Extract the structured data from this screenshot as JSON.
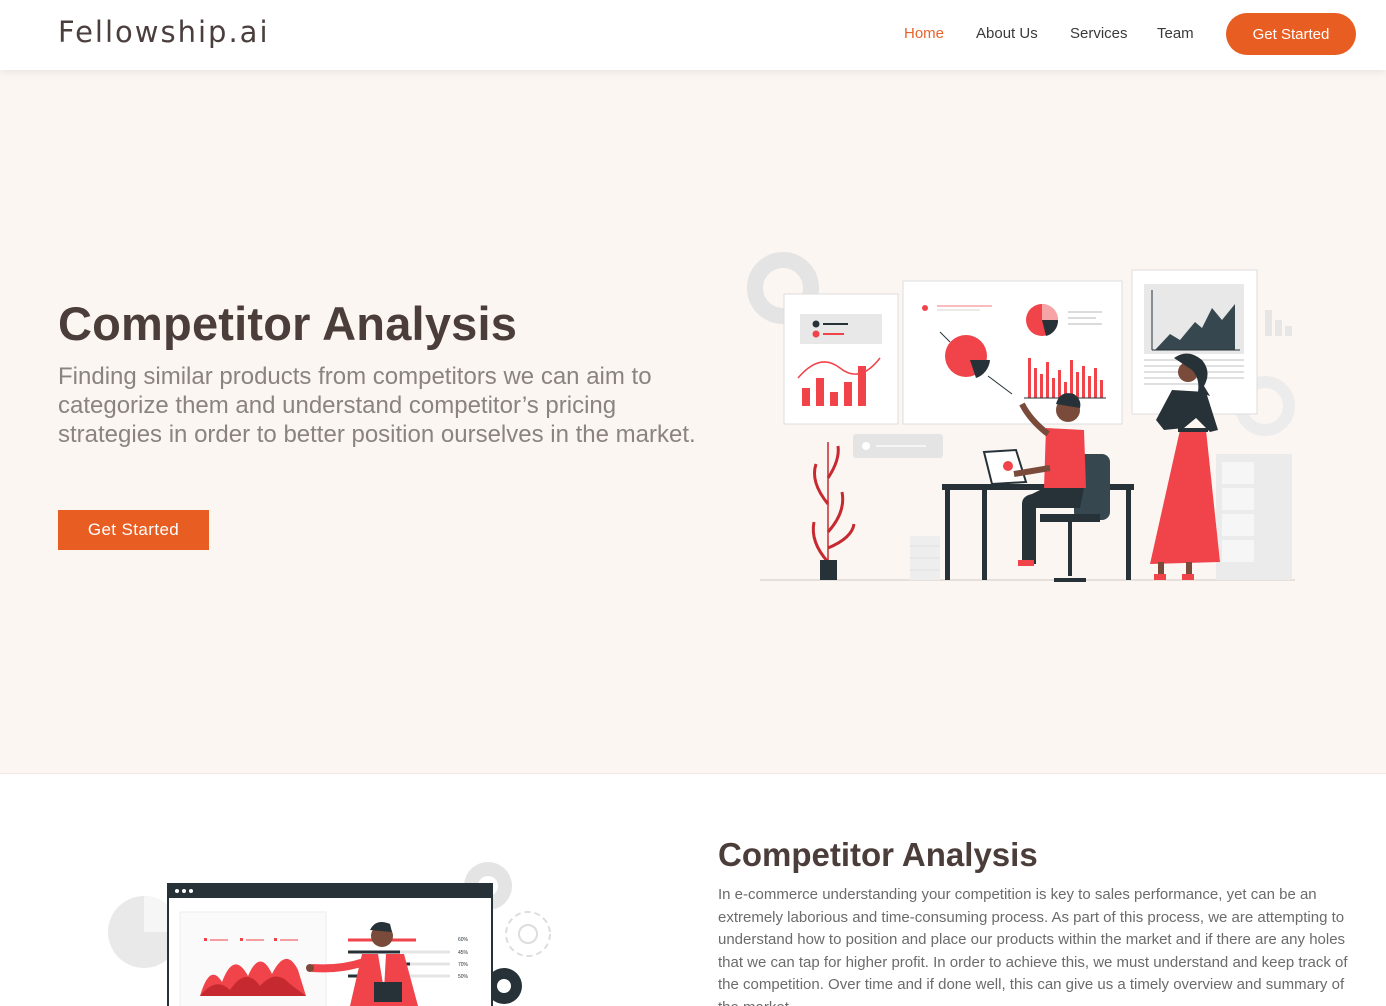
{
  "header": {
    "logo": "Fellowship.ai",
    "nav": [
      {
        "label": "Home",
        "active": true
      },
      {
        "label": "About Us",
        "active": false
      },
      {
        "label": "Services",
        "active": false
      },
      {
        "label": "Team",
        "active": false
      }
    ],
    "cta_label": "Get Started"
  },
  "hero": {
    "title": "Competitor Analysis",
    "description": "Finding similar products from competitors we can aim to categorize them and understand competitor’s pricing strategies in order to better position ourselves in the market.",
    "button_label": "Get Started"
  },
  "section2": {
    "title": "Competitor Analysis",
    "body": "In e-commerce understanding your competition is key to sales performance, yet can be an extremely laborious and time-consuming process. As part of this process, we are attempting to understand how to position and place our products within the market and if there are any holes that we can tap for higher profit. In order to achieve this, we must understand and keep track of the competition. Over time and if done well, this can give us a timely overview and summary of the market.",
    "illustration_labels": [
      "60%",
      "45%",
      "70%",
      "50%"
    ]
  },
  "colors": {
    "accent": "#e85d22",
    "hero_bg": "#fcf6f3",
    "heading": "#4a3d3a",
    "illustration_red": "#f0434a",
    "illustration_dark": "#263238"
  }
}
